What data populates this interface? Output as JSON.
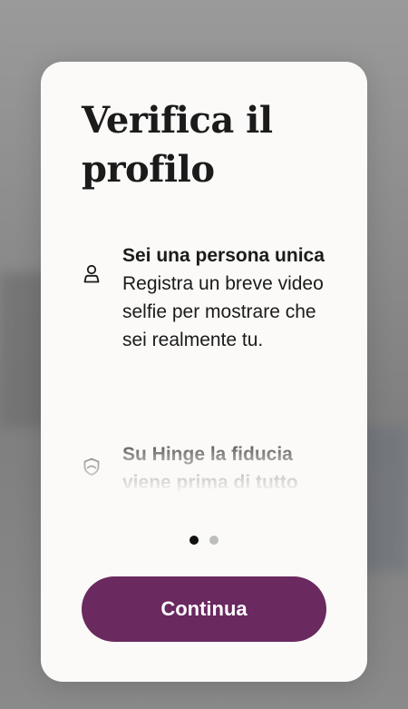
{
  "modal": {
    "title": "Verifica il profilo",
    "features": [
      {
        "icon": "person-icon",
        "heading": "Sei una persona unica",
        "body": "Registra un breve video selfie per mostrare che sei realmente tu."
      },
      {
        "icon": "shield-icon",
        "heading": "Su Hinge la fiducia viene prima di tutto",
        "body": ""
      }
    ],
    "pagination": {
      "total": 2,
      "active_index": 0
    },
    "cta_label": "Continua"
  },
  "colors": {
    "accent": "#6a295f",
    "modal_bg": "#fbfaf8",
    "text": "#1b1b1b",
    "dot_active": "#111111",
    "dot_inactive": "#bdbdbd"
  }
}
